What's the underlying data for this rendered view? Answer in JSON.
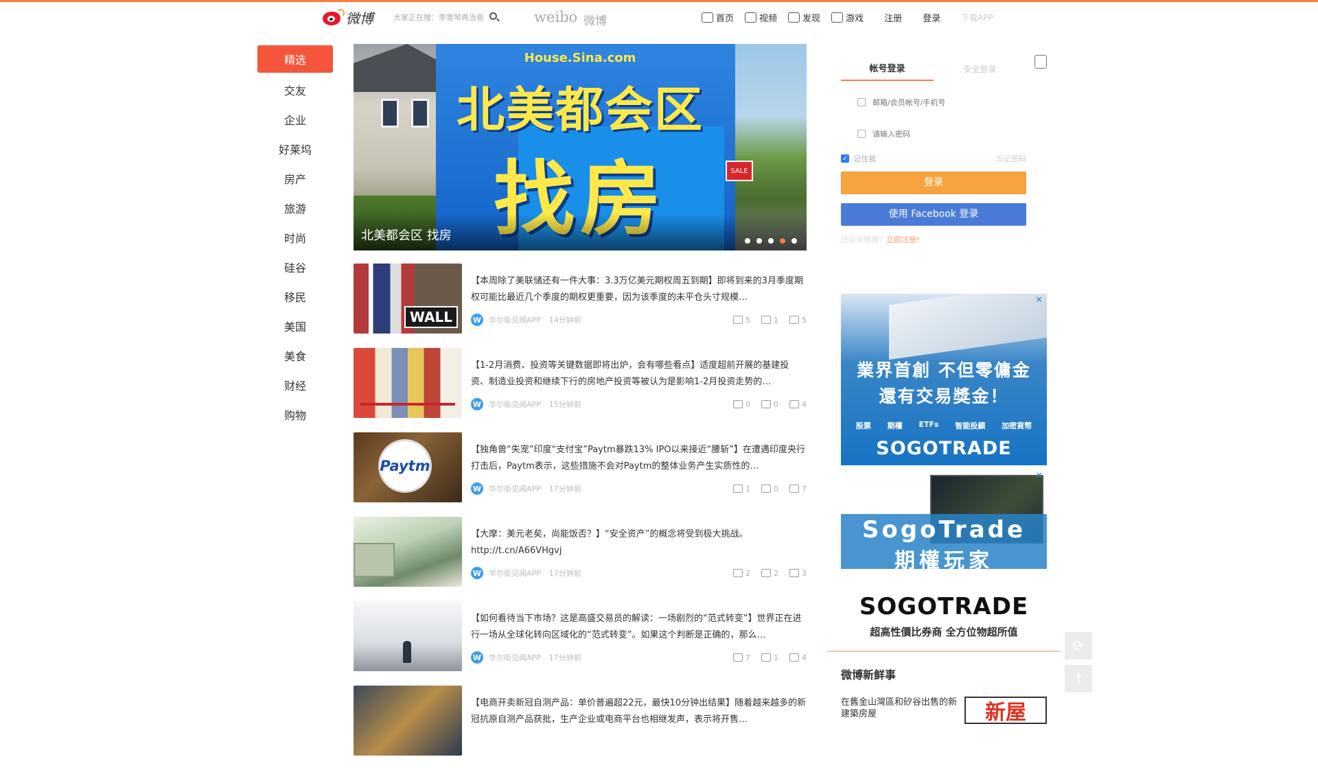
{
  "header": {
    "logo_text": "微博",
    "hot_search": "大家正在搜：李雪琴再当爸",
    "wordmark": "weibo",
    "wordmark_cn": "微博",
    "nav": [
      {
        "label": "首页",
        "icon": "home-icon"
      },
      {
        "label": "视频",
        "icon": "video-icon"
      },
      {
        "label": "发现",
        "icon": "discover-icon"
      },
      {
        "label": "游戏",
        "icon": "game-icon"
      }
    ],
    "register": "注册",
    "login": "登录",
    "faint_link": "下载APP"
  },
  "leftmenu": [
    "精选",
    "交友",
    "企业",
    "好莱坞",
    "房产",
    "旅游",
    "时尚",
    "硅谷",
    "移民",
    "美国",
    "美食",
    "财经",
    "购物"
  ],
  "banner": {
    "site": "House.Sina.com",
    "headline1": "北美都会区",
    "headline2": "找房",
    "caption": "北美都会区 找房",
    "sign": "SALE",
    "dots_count": 5,
    "active_dot": 3
  },
  "feed": [
    {
      "text": "【本周除了美联储还有一件大事：3.3万亿美元期权周五到期】即将到来的3月季度期权可能比最近几个季度的期权更重要，因为该季度的未平仓头寸规模…",
      "source": "华尔街见闻APP",
      "time": "14分钟前",
      "share": "5",
      "comment": "1",
      "like": "5",
      "thumb_label": "WALL"
    },
    {
      "text": "【1-2月消费、投资等关键数据即将出炉，会有哪些看点】适度超前开展的基建投资、制造业投资和继续下行的房地产投资等被认为是影响1-2月投资走势的…",
      "source": "华尔街见闻APP",
      "time": "15分钟前",
      "share": "0",
      "comment": "0",
      "like": "4",
      "thumb_label": ""
    },
    {
      "text": "【独角兽“失宠”印度“支付宝”Paytm暴跌13% IPO以来接近“腰斩”】在遭遇印度央行打击后，Paytm表示，这些措施不会对Paytm的整体业务产生实质性的…",
      "source": "华尔街见闻APP",
      "time": "17分钟前",
      "share": "1",
      "comment": "0",
      "like": "7",
      "thumb_label": "Paytm"
    },
    {
      "text": "【大摩：美元老矣，尚能饭否？】“安全资产”的概念将受到极大挑战。 http://t.cn/A66VHgvj",
      "source": "华尔街见闻APP",
      "time": "17分钟前",
      "share": "2",
      "comment": "2",
      "like": "3",
      "thumb_label": ""
    },
    {
      "text": "【如何看待当下市场？这是高盛交易员的解读：一场剧烈的“范式转变”】世界正在进行一场从全球化转向区域化的“范式转变”。如果这个判断是正确的，那么…",
      "source": "华尔街见闻APP",
      "time": "17分钟前",
      "share": "7",
      "comment": "1",
      "like": "4",
      "thumb_label": ""
    },
    {
      "text": "【电商开卖新冠自测产品：单价普遍超22元，最快10分钟出结果】随着越来越多的新冠抗原自测产品获批，生产企业或电商平台也相继发声，表示将开售…",
      "source": "华尔街见闻APP",
      "time": "",
      "share": "",
      "comment": "",
      "like": "",
      "thumb_label": ""
    }
  ],
  "login": {
    "tab_account": "帐号登录",
    "tab_secure": "安全登录",
    "username_placeholder": "邮箱/会员帐号/手机号",
    "password_placeholder": "请输入密码",
    "remember": "记住我",
    "forgot": "忘记密码",
    "login_btn": "登录",
    "facebook_btn": "使用 Facebook 登录",
    "register_prompt": "还没有微博？",
    "register_link": "立即注册!"
  },
  "ads": [
    {
      "line1": "業界首創 不但零傭金",
      "line2": "還有交易獎金！",
      "categories": [
        "股票",
        "期權",
        "ETFs",
        "智能投顧",
        "加密貨幣"
      ],
      "brand": "SOGOTRADE"
    },
    {
      "line1": "SogoTrade",
      "line2": "期權玩家",
      "brand": "SOGOTRADE",
      "tagline": "超高性價比券商 全方位物超所值"
    }
  ],
  "fresh": {
    "title": "微博新鲜事",
    "item_text": "在舊金山灣區和矽谷出售的新建築房屋",
    "item_img_text": "新屋"
  },
  "colors": {
    "accent": "#fa7d3c",
    "menu_active": "#f4553b",
    "login_btn": "#f7a440",
    "facebook_btn": "#4a7bd8"
  }
}
